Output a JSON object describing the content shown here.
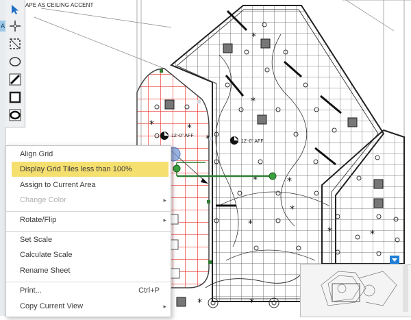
{
  "sheet": {
    "title": "APE AS CEILING ACCENT"
  },
  "left_tab": {
    "label": "A"
  },
  "annotations": {
    "grid_label_1": "12'-0\" AFF",
    "grid_label_2": "12'-0\" AFF"
  },
  "toolbar": {
    "tools": [
      {
        "name": "select-arrow-icon"
      },
      {
        "name": "crosshair-icon"
      },
      {
        "name": "grid-area-icon"
      },
      {
        "name": "ellipse-icon"
      },
      {
        "name": "line-icon"
      },
      {
        "name": "rectangle-icon"
      },
      {
        "name": "rounded-shape-icon"
      }
    ]
  },
  "context_menu": {
    "items": [
      {
        "label": "Align Grid",
        "state": "normal"
      },
      {
        "label": "Display Grid Tiles less than 100%",
        "state": "highlighted"
      },
      {
        "label": "Assign to Current Area",
        "state": "normal"
      },
      {
        "label": "Change Color",
        "state": "disabled",
        "submenu": true
      },
      {
        "label": "Rotate/Flip",
        "state": "normal",
        "submenu": true
      },
      {
        "label": "Set Scale",
        "state": "normal"
      },
      {
        "label": "Calculate Scale",
        "state": "normal"
      },
      {
        "label": "Rename Sheet",
        "state": "normal"
      },
      {
        "label": "Print...",
        "state": "normal",
        "shortcut": "Ctrl+P"
      },
      {
        "label": "Copy Current View",
        "state": "normal",
        "submenu": true
      }
    ]
  },
  "colors": {
    "highlight": "#f5df6f",
    "grid_red": "#e8322c",
    "grid_green": "#2e7d32",
    "accent_blue": "#1f7fd6"
  }
}
